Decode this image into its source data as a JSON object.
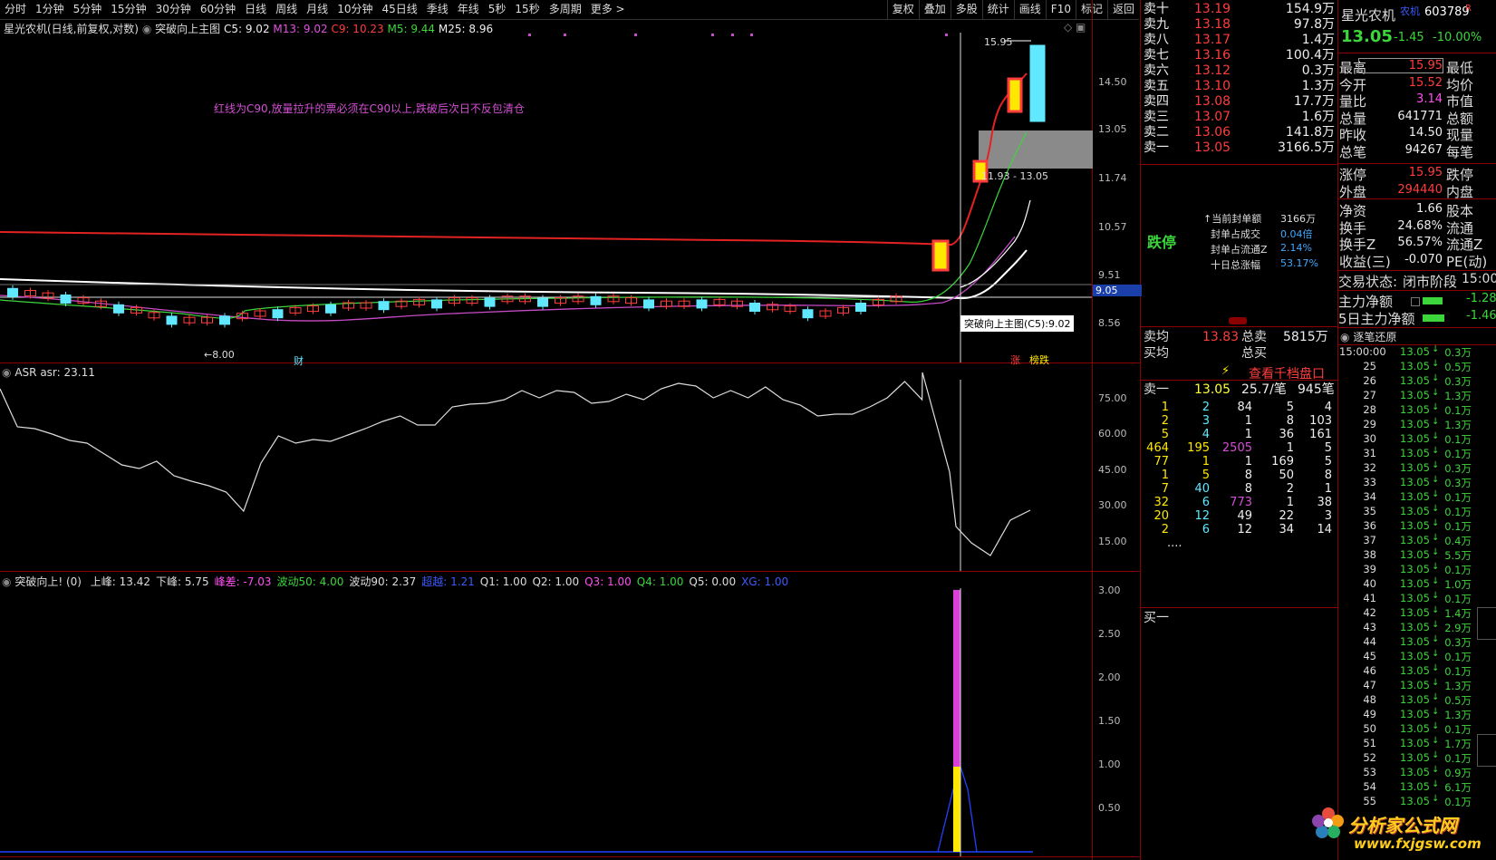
{
  "toolbar": {
    "tabs": [
      "分时",
      "1分钟",
      "5分钟",
      "15分钟",
      "30分钟",
      "60分钟",
      "日线",
      "周线",
      "月线",
      "10分钟",
      "45日线",
      "季线",
      "年线",
      "5秒",
      "15秒",
      "多周期",
      "更多 >"
    ],
    "right": [
      "复权",
      "叠加",
      "多股",
      "统计",
      "画线",
      "F10",
      "标记",
      "返回"
    ]
  },
  "main_chart": {
    "header_stock": "星光农机(日线,前复权,对数)",
    "indicator_name": "突破向上主图",
    "c5": "C5: 9.02",
    "m13": "M13: 9.02",
    "c9": "C9: 10.23",
    "m5": "M5: 9.44",
    "m25": "M25: 8.96",
    "annotation": "红线为C90,放量拉升的票必须在C90以上,跌破后次日不反包清仓",
    "y_ticks": [
      "14.50",
      "13.05",
      "11.74",
      "10.57",
      "9.51",
      "8.56"
    ],
    "high_label": "15.95",
    "low_label": "8.00",
    "range_label": "11.93 - 13.05",
    "tooltip": "突破向上主图(C5):9.02",
    "price_marker": "9.05",
    "marker_cai": "财",
    "marker_zhang": "涨",
    "marker_bangdie": "榜跌"
  },
  "asr": {
    "title": "ASR",
    "value_label": "asr: 23.11",
    "y_ticks": [
      "75.00",
      "60.00",
      "45.00",
      "30.00",
      "15.00"
    ]
  },
  "sub_chart": {
    "title": "突破向上!",
    "params": "(0)",
    "items": [
      {
        "label": "上峰: 13.42",
        "color": "#dddddd"
      },
      {
        "label": "下峰: 5.75",
        "color": "#dddddd"
      },
      {
        "label": "峰差: -7.03",
        "color": "#ff4ff0"
      },
      {
        "label": "波动50: 4.00",
        "color": "#3cd63c"
      },
      {
        "label": "波动90: 2.37",
        "color": "#dddddd"
      },
      {
        "label": "超越: 1.21",
        "color": "#3b5bff"
      },
      {
        "label": "Q1: 1.00",
        "color": "#dddddd"
      },
      {
        "label": "Q2: 1.00",
        "color": "#dddddd"
      },
      {
        "label": "Q3: 1.00",
        "color": "#ff4ff0"
      },
      {
        "label": "Q4: 1.00",
        "color": "#3cd63c"
      },
      {
        "label": "Q5: 0.00",
        "color": "#dddddd"
      },
      {
        "label": "XG: 1.00",
        "color": "#3b5bff"
      }
    ],
    "y_ticks": [
      "3.00",
      "2.50",
      "2.00",
      "1.50",
      "1.00",
      "0.50"
    ]
  },
  "order_book": {
    "sells": [
      {
        "label": "卖十",
        "price": "13.19",
        "vol": "154.9万"
      },
      {
        "label": "卖九",
        "price": "13.18",
        "vol": "97.8万"
      },
      {
        "label": "卖八",
        "price": "13.17",
        "vol": "1.4万"
      },
      {
        "label": "卖七",
        "price": "13.16",
        "vol": "100.4万"
      },
      {
        "label": "卖六",
        "price": "13.12",
        "vol": "0.3万"
      },
      {
        "label": "卖五",
        "price": "13.10",
        "vol": "1.3万"
      },
      {
        "label": "卖四",
        "price": "13.08",
        "vol": "17.7万"
      },
      {
        "label": "卖三",
        "price": "13.07",
        "vol": "1.6万"
      },
      {
        "label": "卖二",
        "price": "13.06",
        "vol": "141.8万"
      },
      {
        "label": "卖一",
        "price": "13.05",
        "vol": "3166.5万"
      }
    ],
    "limit_down_label": "跌停",
    "seal_info": [
      {
        "label": "当前封单额",
        "value": "3166万"
      },
      {
        "label": "封单占成交",
        "value": "0.04倍"
      },
      {
        "label": "封单占流通Z",
        "value": "2.14%"
      },
      {
        "label": "十日总涨幅",
        "value": "53.17%"
      }
    ],
    "avg_sell_label": "卖均",
    "avg_sell": "13.83",
    "total_sell_label": "总卖",
    "total_sell": "5815万",
    "avg_buy_label": "买均",
    "total_buy_label": "总买",
    "depth_button": "查看千档盘口",
    "sell1_label": "卖一",
    "sell1_price": "13.05",
    "sell1_per": "25.7/笔",
    "sell1_count": "945笔",
    "depth_rows": [
      [
        "1",
        "2",
        "84",
        "5",
        "4"
      ],
      [
        "2",
        "3",
        "1",
        "8",
        "103"
      ],
      [
        "5",
        "4",
        "1",
        "36",
        "161"
      ],
      [
        "464",
        "195",
        "2505",
        "1",
        "5"
      ],
      [
        "77",
        "1",
        "1",
        "169",
        "5"
      ],
      [
        "1",
        "5",
        "8",
        "50",
        "8"
      ],
      [
        "7",
        "40",
        "8",
        "2",
        "1"
      ],
      [
        "32",
        "6",
        "773",
        "1",
        "38"
      ],
      [
        "20",
        "12",
        "49",
        "22",
        "3"
      ],
      [
        "2",
        "6",
        "12",
        "34",
        "14"
      ]
    ],
    "ellipsis": "....",
    "buy1_label": "买一"
  },
  "quote": {
    "name": "星光农机",
    "tag": "农机",
    "code": "603789",
    "r": "R",
    "price": "13.05",
    "change": "-1.45",
    "pct": "-10.00%",
    "rows": [
      {
        "l": "最高",
        "v": "15.95",
        "r": "最低",
        "vc": "#ff3d3d",
        "box": true
      },
      {
        "l": "今开",
        "v": "15.52",
        "r": "均价",
        "vc": "#ff3d3d"
      },
      {
        "l": "量比",
        "v": "3.14",
        "r": "市值",
        "vc": "#ff4ff0"
      },
      {
        "l": "总量",
        "v": "641771",
        "r": "总额",
        "vc": "#eeeeee"
      },
      {
        "l": "昨收",
        "v": "14.50",
        "r": "现量",
        "vc": "#eeeeee"
      },
      {
        "l": "总笔",
        "v": "94267",
        "r": "每笔",
        "vc": "#eeeeee"
      }
    ],
    "rows2": [
      {
        "l": "涨停",
        "v": "15.95",
        "r": "跌停",
        "vc": "#ff3d3d"
      },
      {
        "l": "外盘",
        "v": "294440",
        "r": "内盘",
        "vc": "#ff3d3d"
      }
    ],
    "rows3": [
      {
        "l": "净资",
        "v": "1.66",
        "r": "股本"
      },
      {
        "l": "换手",
        "v": "24.68%",
        "r": "流通"
      },
      {
        "l": "换手Z",
        "v": "56.57%",
        "r": "流通Z"
      },
      {
        "l": "收益(三)",
        "v": "-0.070",
        "r": "PE(动)"
      }
    ],
    "trade_state_label": "交易状态:",
    "trade_state": "闭市阶段",
    "trade_time": "15:00",
    "main_net_label": "主力净额",
    "main_net": "-1.28",
    "main5_label": "5日主力净额",
    "main5": "-1.46",
    "tick_title": "逐笔还原"
  },
  "ticks": {
    "first_time": "15:00:00",
    "rows": [
      {
        "t": "",
        "p": "13.05",
        "v": "0.3万"
      },
      {
        "t": "25",
        "p": "13.05",
        "v": "0.5万"
      },
      {
        "t": "26",
        "p": "13.05",
        "v": "0.3万"
      },
      {
        "t": "27",
        "p": "13.05",
        "v": "1.3万"
      },
      {
        "t": "28",
        "p": "13.05",
        "v": "0.1万"
      },
      {
        "t": "29",
        "p": "13.05",
        "v": "1.3万"
      },
      {
        "t": "30",
        "p": "13.05",
        "v": "0.1万"
      },
      {
        "t": "31",
        "p": "13.05",
        "v": "0.1万"
      },
      {
        "t": "32",
        "p": "13.05",
        "v": "0.3万"
      },
      {
        "t": "33",
        "p": "13.05",
        "v": "0.3万"
      },
      {
        "t": "34",
        "p": "13.05",
        "v": "0.1万"
      },
      {
        "t": "35",
        "p": "13.05",
        "v": "0.1万"
      },
      {
        "t": "36",
        "p": "13.05",
        "v": "0.1万"
      },
      {
        "t": "37",
        "p": "13.05",
        "v": "0.4万"
      },
      {
        "t": "38",
        "p": "13.05",
        "v": "5.5万"
      },
      {
        "t": "39",
        "p": "13.05",
        "v": "0.1万"
      },
      {
        "t": "40",
        "p": "13.05",
        "v": "1.0万"
      },
      {
        "t": "41",
        "p": "13.05",
        "v": "0.1万"
      },
      {
        "t": "42",
        "p": "13.05",
        "v": "1.4万"
      },
      {
        "t": "43",
        "p": "13.05",
        "v": "2.9万"
      },
      {
        "t": "44",
        "p": "13.05",
        "v": "0.3万"
      },
      {
        "t": "45",
        "p": "13.05",
        "v": "0.1万"
      },
      {
        "t": "46",
        "p": "13.05",
        "v": "0.1万"
      },
      {
        "t": "47",
        "p": "13.05",
        "v": "1.3万"
      },
      {
        "t": "48",
        "p": "13.05",
        "v": "0.5万"
      },
      {
        "t": "49",
        "p": "13.05",
        "v": "1.3万"
      },
      {
        "t": "50",
        "p": "13.05",
        "v": "0.1万"
      },
      {
        "t": "51",
        "p": "13.05",
        "v": "1.7万"
      },
      {
        "t": "52",
        "p": "13.05",
        "v": "0.1万"
      },
      {
        "t": "53",
        "p": "13.05",
        "v": "0.9万"
      },
      {
        "t": "54",
        "p": "13.05",
        "v": "6.1万"
      },
      {
        "t": "55",
        "p": "13.05",
        "v": "0.1万"
      }
    ]
  },
  "watermark": {
    "title": "分析家公式网",
    "url": "www.fxjgsw.com"
  },
  "colors": {
    "frame": "#8b0000",
    "up": "#ff3d3d",
    "down": "#5fe8ff",
    "yellow": "#ffe800",
    "magenta": "#d93fd9"
  }
}
